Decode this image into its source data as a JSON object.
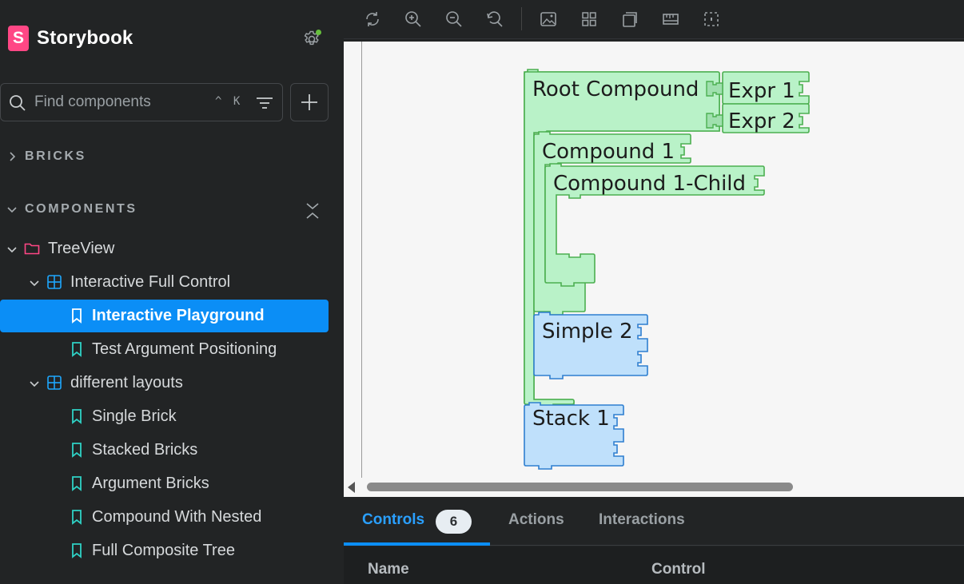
{
  "brand": {
    "logo_letter": "S",
    "name": "Storybook"
  },
  "search": {
    "placeholder": "Find components",
    "shortcut": "^ K"
  },
  "sections": {
    "bricks": "BRICKS",
    "components": "COMPONENTS"
  },
  "tree": {
    "root": "TreeView",
    "group1": "Interactive Full Control",
    "stories1": [
      "Interactive Playground",
      "Test Argument Positioning"
    ],
    "group2": "different layouts",
    "stories2": [
      "Single Brick",
      "Stacked Bricks",
      "Argument Bricks",
      "Compound With Nested",
      "Full Composite Tree"
    ]
  },
  "canvas": {
    "blocks": {
      "root_compound": "Root Compound",
      "expr1": "Expr 1",
      "expr2": "Expr 2",
      "compound1": "Compound 1",
      "compound1_child": "Compound 1-Child",
      "simple2": "Simple 2",
      "stack1": "Stack 1"
    },
    "colors": {
      "green_fill": "#b9f2c8",
      "green_stroke": "#4caf50",
      "blue_fill": "#bfe0fb",
      "blue_stroke": "#2f7fd0"
    }
  },
  "panel": {
    "tabs": {
      "controls": "Controls",
      "controls_count": "6",
      "actions": "Actions",
      "interactions": "Interactions"
    },
    "columns": {
      "name": "Name",
      "control": "Control"
    }
  },
  "theme": {
    "accent": "#0b8ef6",
    "brand": "#ff4785",
    "story_icon": "#2fd1c5",
    "component_icon": "#1ea7fd",
    "folder_icon": "#ff4785"
  }
}
